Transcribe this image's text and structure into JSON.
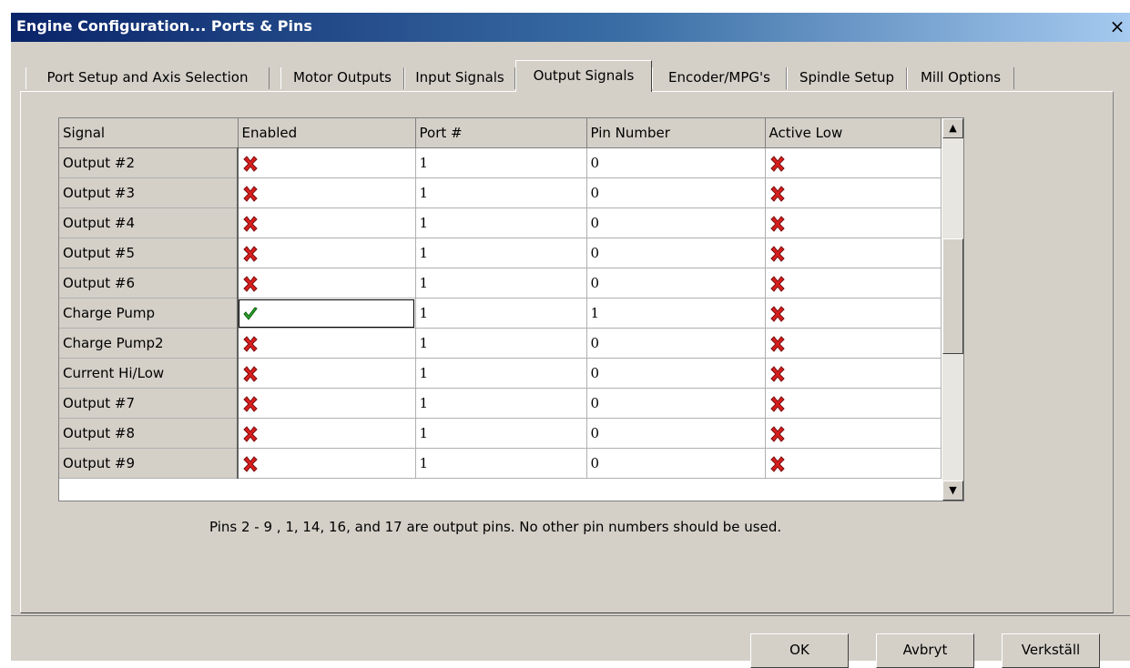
{
  "window": {
    "title": "Engine Configuration... Ports & Pins",
    "close_glyph": "×"
  },
  "tabs": [
    {
      "label": "Port Setup and Axis Selection",
      "active": false
    },
    {
      "label": "Motor Outputs",
      "active": false
    },
    {
      "label": "Input Signals",
      "active": false
    },
    {
      "label": "Output Signals",
      "active": true
    },
    {
      "label": "Encoder/MPG's",
      "active": false
    },
    {
      "label": "Spindle Setup",
      "active": false
    },
    {
      "label": "Mill Options",
      "active": false
    }
  ],
  "grid": {
    "columns": [
      "Signal",
      "Enabled",
      "Port #",
      "Pin Number",
      "Active Low"
    ],
    "rows": [
      {
        "signal": "Output #2",
        "enabled": false,
        "port": "1",
        "pin": "0",
        "active_low": false
      },
      {
        "signal": "Output #3",
        "enabled": false,
        "port": "1",
        "pin": "0",
        "active_low": false
      },
      {
        "signal": "Output #4",
        "enabled": false,
        "port": "1",
        "pin": "0",
        "active_low": false
      },
      {
        "signal": "Output #5",
        "enabled": false,
        "port": "1",
        "pin": "0",
        "active_low": false
      },
      {
        "signal": "Output #6",
        "enabled": false,
        "port": "1",
        "pin": "0",
        "active_low": false
      },
      {
        "signal": "Charge Pump",
        "enabled": true,
        "port": "1",
        "pin": "1",
        "active_low": false
      },
      {
        "signal": "Charge Pump2",
        "enabled": false,
        "port": "1",
        "pin": "0",
        "active_low": false
      },
      {
        "signal": "Current Hi/Low",
        "enabled": false,
        "port": "1",
        "pin": "0",
        "active_low": false
      },
      {
        "signal": "Output #7",
        "enabled": false,
        "port": "1",
        "pin": "0",
        "active_low": false
      },
      {
        "signal": "Output #8",
        "enabled": false,
        "port": "1",
        "pin": "0",
        "active_low": false
      },
      {
        "signal": "Output #9",
        "enabled": false,
        "port": "1",
        "pin": "0",
        "active_low": false
      }
    ],
    "selected_row": 5,
    "scroll_up_glyph": "▲",
    "scroll_down_glyph": "▼",
    "icons": {
      "enabled_true": "check-icon",
      "enabled_false": "x-icon"
    },
    "colors": {
      "x_icon": "#d81e1e",
      "check_icon": "#2ea82e"
    }
  },
  "note": "Pins 2 - 9 , 1, 14, 16, and 17 are output pins. No  other pin numbers should be used.",
  "buttons": {
    "ok": "OK",
    "cancel": "Avbryt",
    "apply": "Verkställ"
  }
}
